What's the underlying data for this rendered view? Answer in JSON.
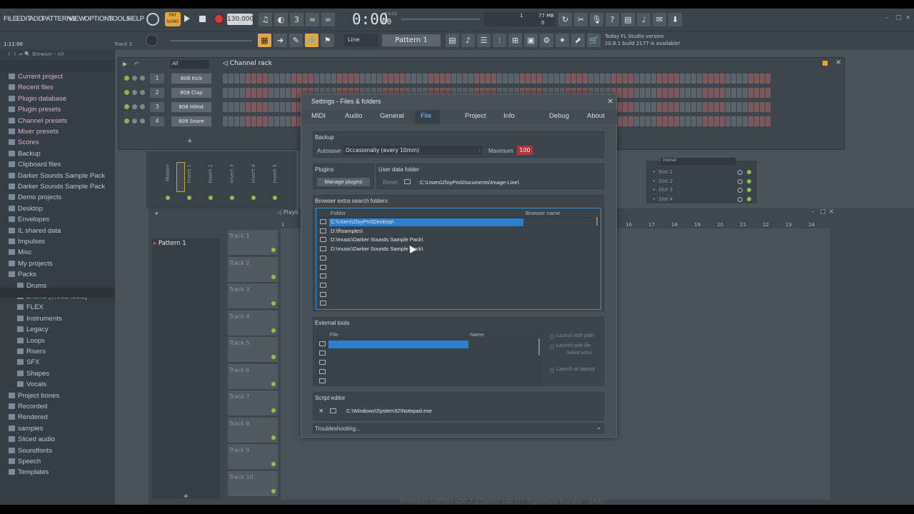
{
  "menu": [
    "FILE",
    "EDIT",
    "ADD",
    "PATTERNS",
    "VIEW",
    "OPTIONS",
    "TOOLS",
    "HELP"
  ],
  "transport": {
    "pat_label": "PAT",
    "song_label": "SONG",
    "tempo": "130.000",
    "time": "0:00",
    "time_sub": "00",
    "mcs": "M:S:CS",
    "cpu_top": "1",
    "mem": "77 MB",
    "cpu_bottom": "0"
  },
  "status": {
    "position": "1:11:00",
    "track": "Track 3",
    "snap": "Line",
    "pattern": "Pattern 1"
  },
  "news": {
    "line1": "Today  FL Studio version",
    "line2": "20.8.1 build 2177 is available!"
  },
  "browser": {
    "header": "Browser - All",
    "items": [
      {
        "label": "Current project",
        "level": 0
      },
      {
        "label": "Recent files",
        "level": 0
      },
      {
        "label": "Plugin database",
        "level": 0
      },
      {
        "label": "Plugin presets",
        "level": 0
      },
      {
        "label": "Channel presets",
        "level": 0
      },
      {
        "label": "Mixer presets",
        "level": 0
      },
      {
        "label": "Scores",
        "level": 0
      },
      {
        "label": "Backup",
        "level": 0
      },
      {
        "label": "Clipboard files",
        "level": 0
      },
      {
        "label": "Darker Sounds Sample Pack",
        "level": 0
      },
      {
        "label": "Darker Sounds Sample Pack",
        "level": 0
      },
      {
        "label": "Demo projects",
        "level": 0
      },
      {
        "label": "Desktop",
        "level": 0
      },
      {
        "label": "Envelopes",
        "level": 0
      },
      {
        "label": "IL shared data",
        "level": 0
      },
      {
        "label": "Impulses",
        "level": 0
      },
      {
        "label": "Misc",
        "level": 0
      },
      {
        "label": "My projects",
        "level": 0
      },
      {
        "label": "Packs",
        "level": 0
      },
      {
        "label": "Drums",
        "level": 1
      },
      {
        "label": "Drums (ModeAudio)",
        "level": 1
      },
      {
        "label": "FLEX",
        "level": 1
      },
      {
        "label": "Instruments",
        "level": 1
      },
      {
        "label": "Legacy",
        "level": 1
      },
      {
        "label": "Loops",
        "level": 1
      },
      {
        "label": "Risers",
        "level": 1
      },
      {
        "label": "SFX",
        "level": 1
      },
      {
        "label": "Shapes",
        "level": 1
      },
      {
        "label": "Vocals",
        "level": 1
      },
      {
        "label": "Project bones",
        "level": 0
      },
      {
        "label": "Recorded",
        "level": 0
      },
      {
        "label": "Rendered",
        "level": 0
      },
      {
        "label": "samples",
        "level": 0
      },
      {
        "label": "Sliced audio",
        "level": 0
      },
      {
        "label": "Soundfonts",
        "level": 0
      },
      {
        "label": "Speech",
        "level": 0
      },
      {
        "label": "Templates",
        "level": 0
      }
    ]
  },
  "rack": {
    "filter": "All",
    "title": "Channel rack",
    "channels": [
      {
        "num": "1",
        "name": "808 Kick"
      },
      {
        "num": "2",
        "name": "808 Clap"
      },
      {
        "num": "3",
        "name": "808 HiHat"
      },
      {
        "num": "4",
        "name": "808 Snare"
      }
    ]
  },
  "mixer": {
    "tracks": [
      "Master",
      "Insert 1",
      "Insert 2",
      "Insert 3",
      "Insert 4",
      "Insert 5"
    ]
  },
  "playlist": {
    "title": "Playli",
    "pattern": "Pattern 1",
    "tracks": [
      "Track 1",
      "Track 2",
      "Track 3",
      "Track 4",
      "Track 5",
      "Track 6",
      "Track 7",
      "Track 8",
      "Track 9",
      "Track 10"
    ],
    "ruler": [
      "16",
      "17",
      "18",
      "19",
      "20",
      "21",
      "22",
      "23",
      "24"
    ]
  },
  "slots": {
    "items": [
      "Slot 1",
      "Slot 2",
      "Slot 3",
      "Slot 4"
    ],
    "header": "(none)"
  },
  "dialog": {
    "title": "Settings - Files & folders",
    "tabs": [
      "MIDI",
      "Audio",
      "General",
      "File",
      "Project",
      "Info",
      "Debug",
      "About"
    ],
    "active_tab": "File",
    "backup": {
      "label": "Backup",
      "autosave_label": "Autosave",
      "autosave_value": "Occasionally (every 10min)",
      "max_label": "Maximum",
      "max_value": "100"
    },
    "plugins": {
      "label": "Plugins",
      "button": "Manage plugins"
    },
    "userdata": {
      "label": "User data folder",
      "reset": "Reset",
      "path": "C:\\Users\\ZloyPro\\Documents\\Image-Line\\"
    },
    "extra": {
      "label": "Browser extra search folders",
      "col_folder": "Folder",
      "col_name": "Browser name",
      "rows": [
        "C:\\Users\\ZloyPro\\Desktop\\",
        "D:\\fl\\samples\\",
        "D:\\music\\Darker Sounds Sample Pack\\",
        "D:\\music\\Darker Sounds Sample Pack\\",
        "",
        "",
        "",
        "",
        "",
        ""
      ]
    },
    "external": {
      "label": "External tools",
      "col_file": "File",
      "col_name": "Name",
      "launch_path": "Launch with path",
      "launch_file": "Launch with file",
      "default_editor": "Default editor",
      "launch_startup": "Launch at startup"
    },
    "script": {
      "label": "Script editor",
      "path": "C:\\Windows\\System32\\Notepad.exe"
    },
    "troubleshooting": "Troubleshooting..."
  },
  "footer": "Producer Edition v20.7.2 [build 1863] - Signature Bundle - 64Bit",
  "colors": {
    "accent": "#e8a53c",
    "selection": "#2f7fd0",
    "record": "#d63b3b",
    "green": "#8fc04a"
  }
}
